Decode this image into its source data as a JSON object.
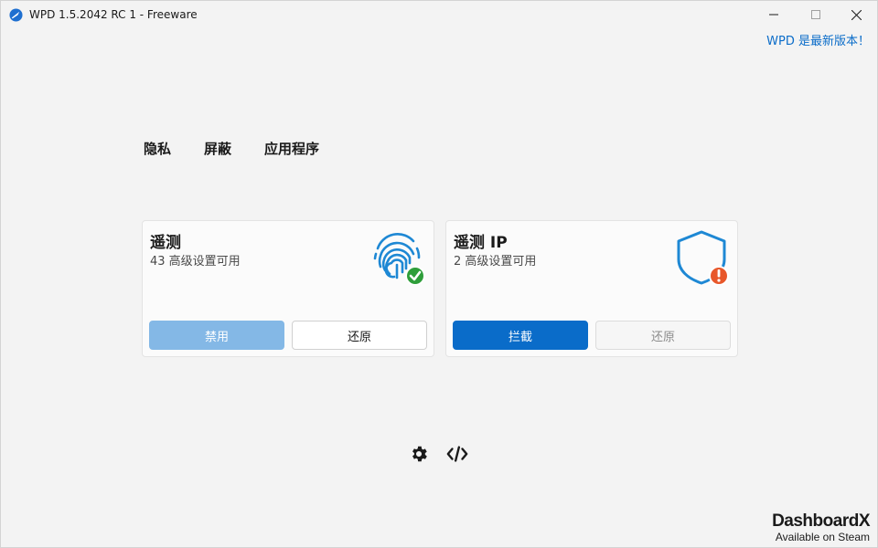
{
  "window": {
    "title": "WPD 1.5.2042 RC 1 - Freeware",
    "update_notice": "WPD 是最新版本！"
  },
  "tabs": [
    {
      "label": "隐私"
    },
    {
      "label": "屏蔽"
    },
    {
      "label": "应用程序"
    }
  ],
  "cards": [
    {
      "title": "遥测",
      "subtitle": "43 高级设置可用",
      "icon": "fingerprint-check-icon",
      "status_color": "#2e9e3a",
      "primary_label": "禁用",
      "secondary_label": "还原"
    },
    {
      "title": "遥测 IP",
      "subtitle": "2 高级设置可用",
      "icon": "shield-warning-icon",
      "status_color": "#e8572a",
      "primary_label": "拦截",
      "secondary_label": "还原"
    }
  ],
  "footer_icons": [
    "gear-icon",
    "code-icon"
  ],
  "watermark": {
    "brand": "DashboardX",
    "sub": "Available on Steam"
  },
  "colors": {
    "accent": "#0a6cc9",
    "accent_disabled": "#84b8e6",
    "background": "#f3f3f3"
  }
}
